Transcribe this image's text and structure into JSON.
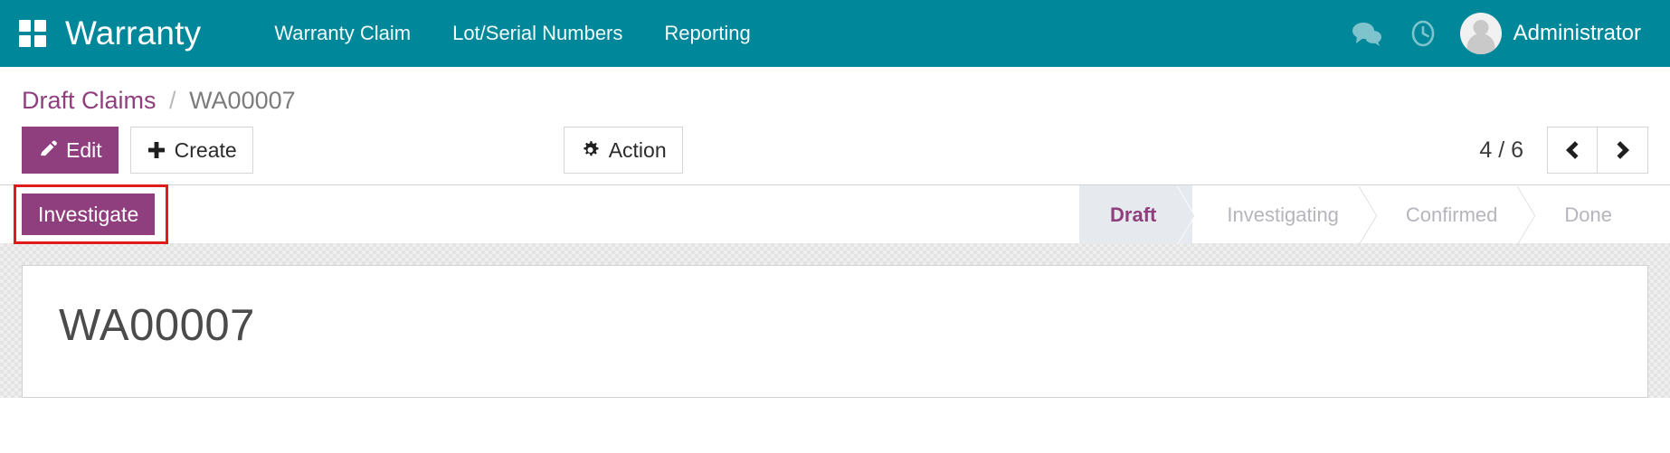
{
  "navbar": {
    "apps_icon": "grid-apps-icon",
    "brand": "Warranty",
    "menu_items": [
      {
        "label": "Warranty Claim"
      },
      {
        "label": "Lot/Serial Numbers"
      },
      {
        "label": "Reporting"
      }
    ],
    "icons": [
      {
        "name": "messages-icon"
      },
      {
        "name": "activities-clock-icon"
      }
    ],
    "user": "Administrator",
    "background_color": "#00889a"
  },
  "breadcrumb": {
    "parent": "Draft Claims",
    "separator": "/",
    "current": "WA00007"
  },
  "toolbar": {
    "edit_label": "Edit",
    "edit_icon": "pencil-icon",
    "create_label": "Create",
    "create_icon": "plus-icon",
    "action_label": "Action",
    "action_icon": "gear-icon",
    "primary_color": "#8f3f7e"
  },
  "pager": {
    "count": "4 / 6",
    "prev_icon": "chevron-left-icon",
    "next_icon": "chevron-right-icon"
  },
  "status_row": {
    "button_label": "Investigate",
    "highlight_color": "#e01b1b",
    "statusbar": [
      {
        "label": "Draft",
        "active": true
      },
      {
        "label": "Investigating",
        "active": false
      },
      {
        "label": "Confirmed",
        "active": false
      },
      {
        "label": "Done",
        "active": false
      }
    ]
  },
  "sheet": {
    "record_title": "WA00007"
  }
}
